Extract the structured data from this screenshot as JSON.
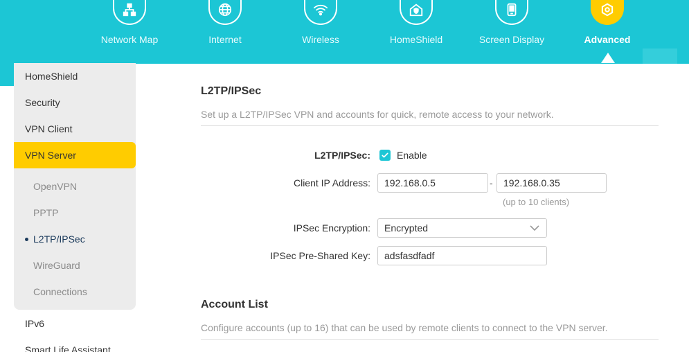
{
  "nav": {
    "items": [
      {
        "label": "Network Map",
        "icon": "network-map-icon"
      },
      {
        "label": "Internet",
        "icon": "globe-icon"
      },
      {
        "label": "Wireless",
        "icon": "wifi-icon"
      },
      {
        "label": "HomeShield",
        "icon": "homeshield-icon"
      },
      {
        "label": "Screen Display",
        "icon": "screen-display-icon"
      },
      {
        "label": "Advanced",
        "icon": "gear-icon",
        "active": true
      }
    ]
  },
  "sidebar": {
    "items": [
      {
        "label": "HomeShield"
      },
      {
        "label": "Security"
      },
      {
        "label": "VPN Client"
      },
      {
        "label": "VPN Server",
        "active": true
      }
    ],
    "sub_items": [
      {
        "label": "OpenVPN"
      },
      {
        "label": "PPTP"
      },
      {
        "label": "L2TP/IPSec",
        "current": true
      },
      {
        "label": "WireGuard"
      },
      {
        "label": "Connections"
      }
    ],
    "bottom_items": [
      {
        "label": "IPv6"
      },
      {
        "label": "Smart Life Assistant"
      }
    ]
  },
  "main": {
    "title": "L2TP/IPSec",
    "description": "Set up a L2TP/IPSec VPN and accounts for quick, remote access to your network.",
    "form": {
      "l2tp_label": "L2TP/IPSec:",
      "enable_label": "Enable",
      "enable_checked": true,
      "client_ip_label": "Client IP Address:",
      "client_ip_start": "192.168.0.5",
      "client_ip_separator": "-",
      "client_ip_end": "192.168.0.35",
      "client_ip_hint": "(up to 10 clients)",
      "encryption_label": "IPSec Encryption:",
      "encryption_value": "Encrypted",
      "psk_label": "IPSec Pre-Shared Key:",
      "psk_value": "adsfasdfadf"
    },
    "account_list": {
      "title": "Account List",
      "description": "Configure accounts (up to 16) that can be used by remote clients to connect to the VPN server."
    }
  },
  "colors": {
    "header": "#1cc6d5",
    "accent_active": "#ffcc00",
    "checkbox": "#1cc6d5"
  }
}
